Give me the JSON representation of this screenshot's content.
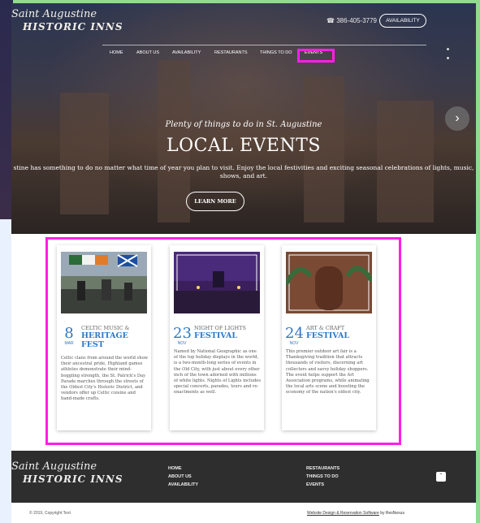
{
  "brand": {
    "logo_line1": "Saint Augustine",
    "logo_line2": "HISTORIC INNS"
  },
  "header": {
    "phone": "☎ 386-405-3779",
    "availability_label": "AVAILABILITY"
  },
  "nav": [
    "HOME",
    "ABOUT US",
    "AVAILABILITY",
    "RESTAURANTS",
    "THINGS TO DO",
    "EVENTS"
  ],
  "hero": {
    "subtitle": "Plenty of things to do in St. Augustine",
    "title": "LOCAL EVENTS",
    "intro_line1": "stine has something to do no matter what time of year you plan to visit. Enjoy the local festivities and exciting seasonal celebrations of lights, music,",
    "intro_line2": "shows, and art.",
    "cta_label": "LEARN MORE",
    "next_icon": "chevron-right-icon"
  },
  "events": [
    {
      "day": "8",
      "month": "MAR",
      "category": "CELTIC MUSIC &",
      "name_line1": "HERITAGE",
      "name_line2": "FEST",
      "description": "Celtic clans from around the world show their ancestral pride, Highland games athletes demonstrate their mind-boggling strength, the St. Patrick's Day Parade marches through the streets of the Oldest City's Historic District, and vendors offer up Celtic cuisine and hand-made crafts."
    },
    {
      "day": "23",
      "month": "NOV",
      "category": "NIGHT OF LIGHTS",
      "name_line1": "FESTIVAL",
      "name_line2": "",
      "description": "Named by National Geographic as one of the top holiday displays in the world, is a two-month-long series of events in the Old City, with just about every other inch of the town adorned with millions of white lights. Nights of Lights includes special concerts, parades, tours and re-enactments as well."
    },
    {
      "day": "24",
      "month": "NOV",
      "category": "ART & CRAFT",
      "name_line1": "FESTIVAL",
      "name_line2": "",
      "description": "This premier outdoor art fair is a Thanksgiving tradition that attracts thousands of visitors, discerning art collectors and savvy holiday shoppers. The event helps support the Art Association programs, while animating the local arts scene and boosting the economy of the nation's oldest city."
    }
  ],
  "footer": {
    "col1": [
      "HOME",
      "ABOUT US",
      "AVAILABILITY"
    ],
    "col2": [
      "RESTAURANTS",
      "THINGS TO DO",
      "EVENTS"
    ],
    "totop_icon": "chevron-up-icon",
    "copyright": "© 2019, Copyright Text",
    "credit_link": "Website Design & Reservation Software",
    "credit_suffix": " by ResNexus"
  },
  "colors": {
    "accent_blue": "#2f78c4",
    "highlight_magenta": "#ff1fe6",
    "footer_bg": "#2e2e2e"
  }
}
